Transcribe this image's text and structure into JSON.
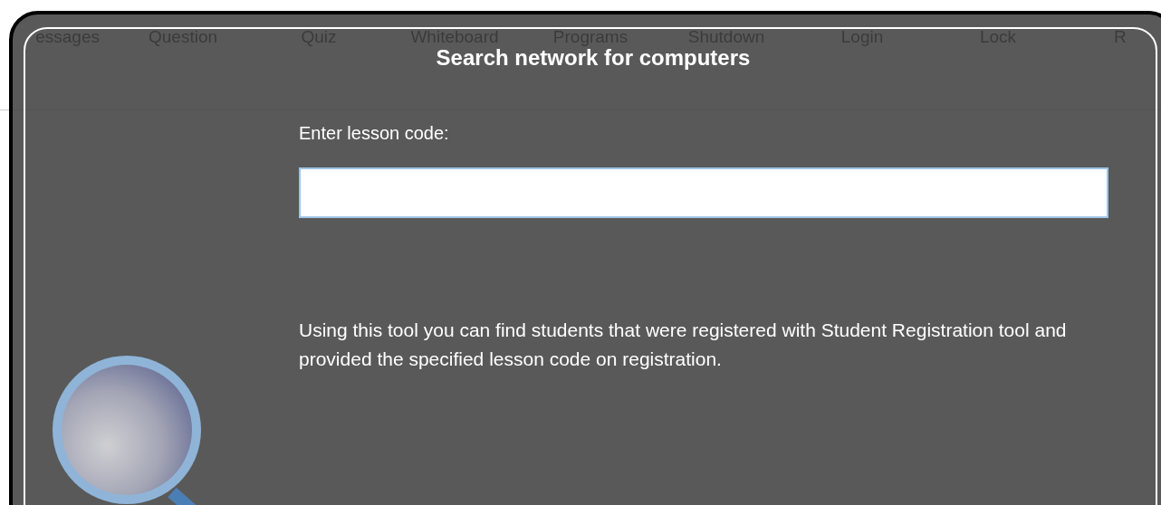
{
  "toolbar": {
    "items": [
      {
        "label": "essages"
      },
      {
        "label": "Question"
      },
      {
        "label": "Quiz"
      },
      {
        "label": "Whiteboard"
      },
      {
        "label": "Programs"
      },
      {
        "label": "Shutdown"
      },
      {
        "label": "Login"
      },
      {
        "label": "Lock"
      },
      {
        "label": "R"
      }
    ]
  },
  "dialog": {
    "title": "Search network for computers",
    "code_label": "Enter lesson code:",
    "description": "Using this tool you can find students that were registered with Student Registration tool and provided the specified lesson code on registration."
  }
}
